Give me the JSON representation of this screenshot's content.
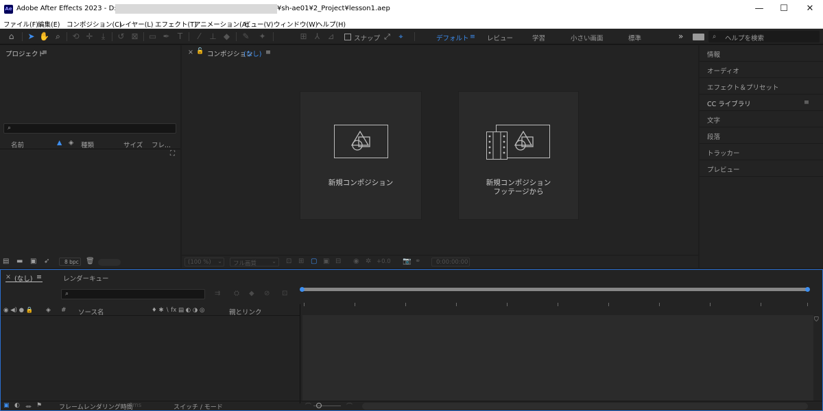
{
  "titlebar": {
    "app_icon": "Ae",
    "title_prefix": "Adobe After Effects 2023 - D:¥",
    "title_suffix": "¥sh-ae01¥2_Project¥lesson1.aep",
    "minimize": "—",
    "maximize": "☐",
    "close": "✕"
  },
  "menu": [
    "ファイル(F)",
    "編集(E)",
    "コンポジション(C)",
    "レイヤー(L)",
    "エフェクト(T)",
    "アニメーション(A)",
    "ビュー(V)",
    "ウィンドウ(W)",
    "ヘルプ(H)"
  ],
  "toolbar": {
    "snap_label": "スナップ",
    "workspaces": [
      "デフォルト",
      "レビュー",
      "学習",
      "小さい画面",
      "標準"
    ],
    "more": "»",
    "help_placeholder": "ヘルプを検索"
  },
  "project": {
    "title": "プロジェクト",
    "menu": "≡",
    "search_icon": "⌕",
    "columns": [
      "名前",
      "種類",
      "サイズ",
      "フレ..."
    ],
    "bpc": "8 bpc"
  },
  "composition": {
    "close": "×",
    "lock": "🔓",
    "title_prefix": "コンポジション",
    "title_none": "(なし)",
    "menu": "≡",
    "card1_label": "新規コンポジション",
    "card2_line1": "新規コンポジション",
    "card2_line2": "フッテージから",
    "zoom": "(100 %)",
    "resolution": "フル画質",
    "exposure": "+0.0",
    "timecode": "0:00:00:00"
  },
  "right_panel": {
    "items": [
      "情報",
      "オーディオ",
      "エフェクト＆プリセット",
      "CC ライブラリ",
      "文字",
      "段落",
      "トラッカー",
      "プレビュー"
    ],
    "menu": "≡"
  },
  "timeline": {
    "close": "×",
    "tab_none": "(なし)",
    "menu": "≡",
    "render_queue": "レンダーキュー",
    "search_icon": "⌕",
    "source_name": "ソース名",
    "hash": "#",
    "parent_link": "親とリンク",
    "switch_icons": "♦ ✱ ∖ fx ▤ ◐ ◑ ◎",
    "av_icons": "◉ ◀) ● 🔒",
    "frame_render_label": "フレームレンダリング時間",
    "frame_render_value": "0ms",
    "switch_mode": "スイッチ / モード"
  }
}
